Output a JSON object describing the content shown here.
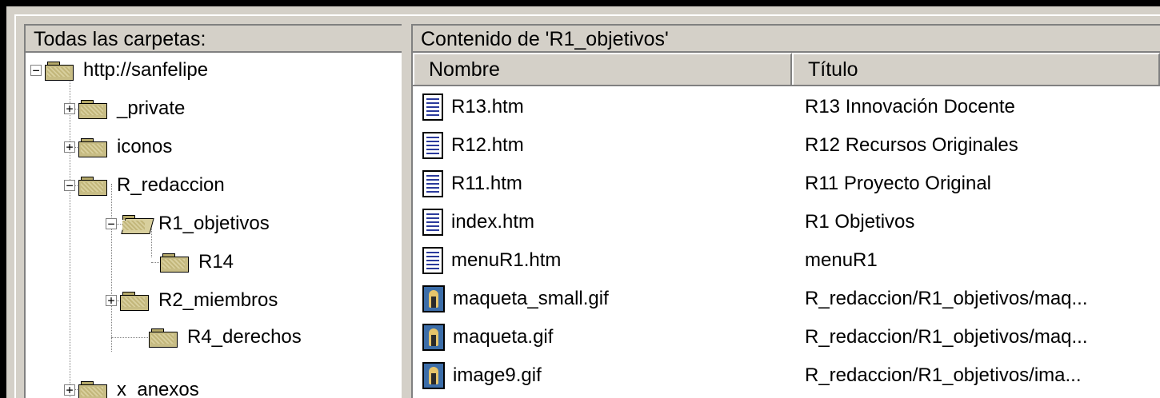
{
  "tree_pane": {
    "caption": "Todas las carpetas:",
    "items": [
      {
        "label": "http://sanfelipe",
        "expander": "−"
      },
      {
        "label": "_private",
        "expander": "+"
      },
      {
        "label": "iconos",
        "expander": "+"
      },
      {
        "label": "R_redaccion",
        "expander": "−"
      },
      {
        "label": "R1_objetivos",
        "expander": "−"
      },
      {
        "label": "R14",
        "expander": ""
      },
      {
        "label": "R2_miembros",
        "expander": "+"
      },
      {
        "label": "R4_derechos",
        "expander": ""
      },
      {
        "label": "x_anexos",
        "expander": "+"
      }
    ]
  },
  "content_pane": {
    "caption": "Contenido de 'R1_objetivos'",
    "columns": {
      "name": "Nombre",
      "title": "Título"
    },
    "files": [
      {
        "name": "R13.htm",
        "title": "R13  Innovación Docente",
        "icon": "html-document-icon"
      },
      {
        "name": "R12.htm",
        "title": "R12  Recursos Originales",
        "icon": "html-document-icon"
      },
      {
        "name": "R11.htm",
        "title": "R11  Proyecto Original",
        "icon": "html-document-icon"
      },
      {
        "name": "index.htm",
        "title": "R1 Objetivos",
        "icon": "html-document-icon"
      },
      {
        "name": "menuR1.htm",
        "title": "menuR1",
        "icon": "html-document-icon"
      },
      {
        "name": "maqueta_small.gif",
        "title": "R_redaccion/R1_objetivos/maq...",
        "icon": "gif-image-icon"
      },
      {
        "name": "maqueta.gif",
        "title": "R_redaccion/R1_objetivos/maq...",
        "icon": "gif-image-icon"
      },
      {
        "name": "image9.gif",
        "title": "R_redaccion/R1_objetivos/ima...",
        "icon": "gif-image-icon"
      }
    ]
  }
}
